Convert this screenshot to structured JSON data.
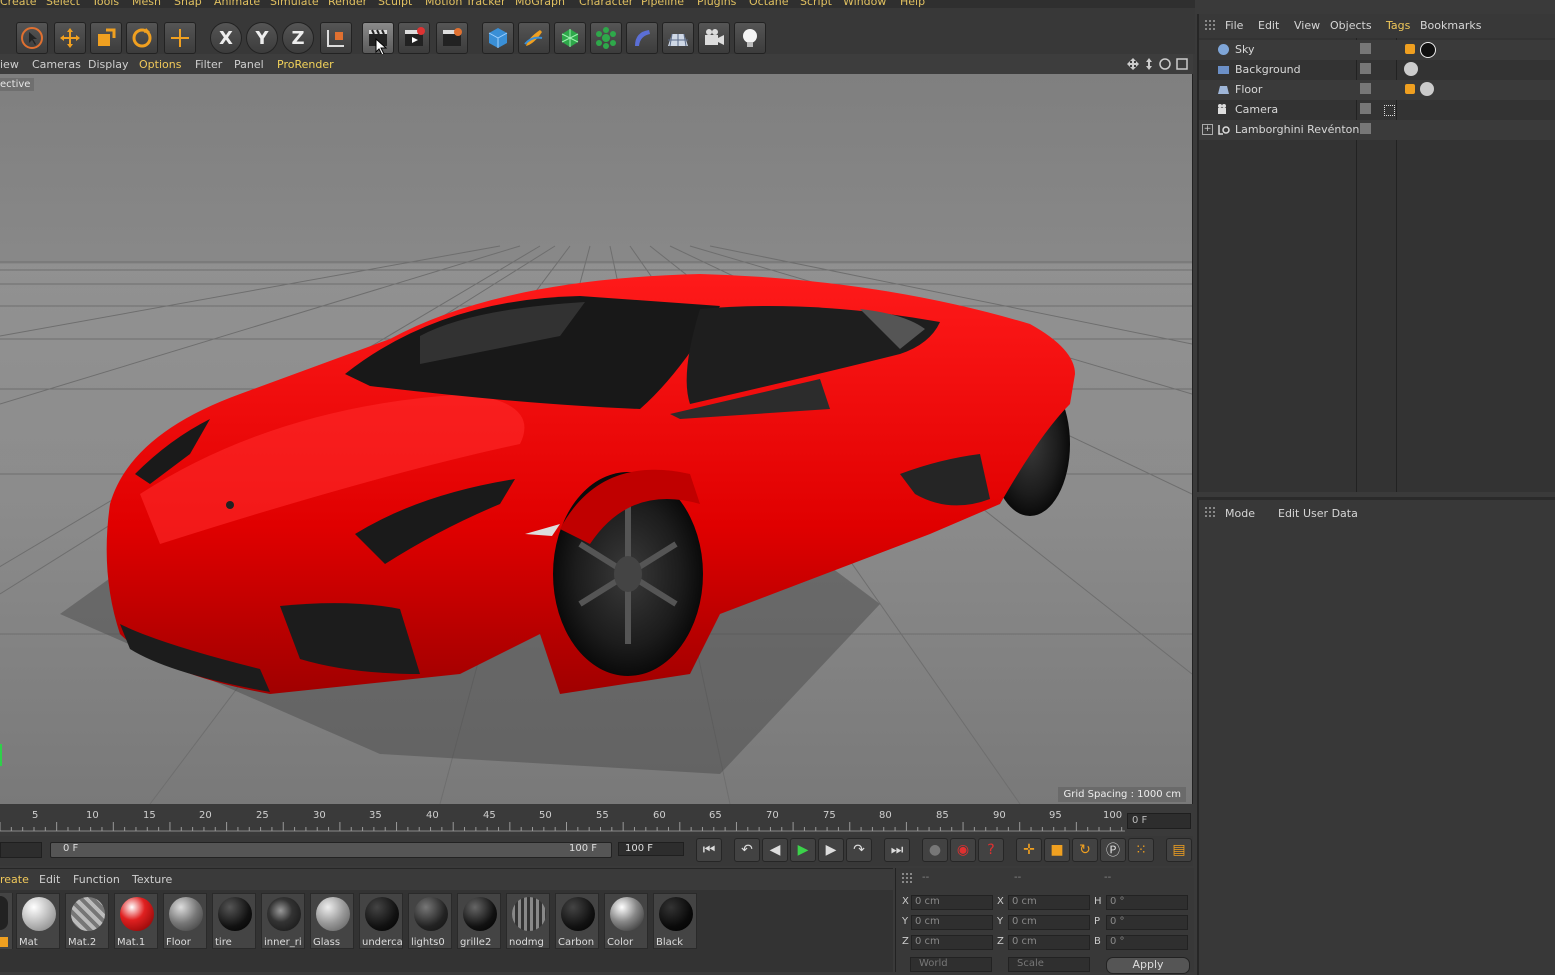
{
  "menubar": [
    "Create",
    "Select",
    "Tools",
    "Mesh",
    "Snap",
    "Animate",
    "Simulate",
    "Render",
    "Sculpt",
    "Motion Tracker",
    "MoGraph",
    "Character",
    "Pipeline",
    "Plugins",
    "Octane",
    "Script",
    "Window",
    "Help"
  ],
  "toolbar": {
    "x_label": "X",
    "y_label": "Y",
    "z_label": "Z"
  },
  "viewport_menu": {
    "items": [
      "iew",
      "Cameras",
      "Display",
      "Options",
      "Filter",
      "Panel",
      "ProRender"
    ]
  },
  "viewport": {
    "camera_label": "ective",
    "grid_spacing": "Grid Spacing : 1000 cm"
  },
  "timeline": {
    "ticks": [
      "5",
      "10",
      "15",
      "20",
      "25",
      "30",
      "35",
      "40",
      "45",
      "50",
      "55",
      "60",
      "65",
      "70",
      "75",
      "80",
      "85",
      "90",
      "95",
      "100"
    ],
    "current_frame": "0 F",
    "slider_start": "0 F",
    "slider_end": "100 F",
    "end_frame": "100 F"
  },
  "material_menu": {
    "items": [
      "reate",
      "Edit",
      "Function",
      "Texture"
    ]
  },
  "materials": [
    {
      "name": "Mat"
    },
    {
      "name": "Mat.2"
    },
    {
      "name": "Mat.1"
    },
    {
      "name": "Floor"
    },
    {
      "name": "tire"
    },
    {
      "name": "inner_ri"
    },
    {
      "name": "Glass"
    },
    {
      "name": "underca"
    },
    {
      "name": "lights0"
    },
    {
      "name": "grille2"
    },
    {
      "name": "nodmg"
    },
    {
      "name": "Carbon"
    },
    {
      "name": "Color"
    },
    {
      "name": "Black"
    }
  ],
  "coord": {
    "headers": [
      "--",
      "--",
      "--"
    ],
    "rows": [
      {
        "a": "X",
        "av": "0 cm",
        "b": "X",
        "bv": "0 cm",
        "c": "H",
        "cv": "0 °"
      },
      {
        "a": "Y",
        "av": "0 cm",
        "b": "Y",
        "bv": "0 cm",
        "c": "P",
        "cv": "0 °"
      },
      {
        "a": "Z",
        "av": "0 cm",
        "b": "Z",
        "bv": "0 cm",
        "c": "B",
        "cv": "0 °"
      }
    ],
    "world": "World",
    "scale": "Scale",
    "apply": "Apply"
  },
  "object_manager": {
    "menu": [
      "File",
      "Edit",
      "View",
      "Objects",
      "Tags",
      "Bookmarks"
    ],
    "objects": [
      {
        "name": "Sky"
      },
      {
        "name": "Background"
      },
      {
        "name": "Floor"
      },
      {
        "name": "Camera"
      },
      {
        "name": "Lamborghini Revénton"
      }
    ]
  },
  "attribute_manager": {
    "menu": [
      "Mode",
      "Edit",
      "User Data"
    ]
  },
  "colors": {
    "accent": "#f0c85a",
    "car_red": "#e00000",
    "active_tab": "#f3d35a"
  }
}
